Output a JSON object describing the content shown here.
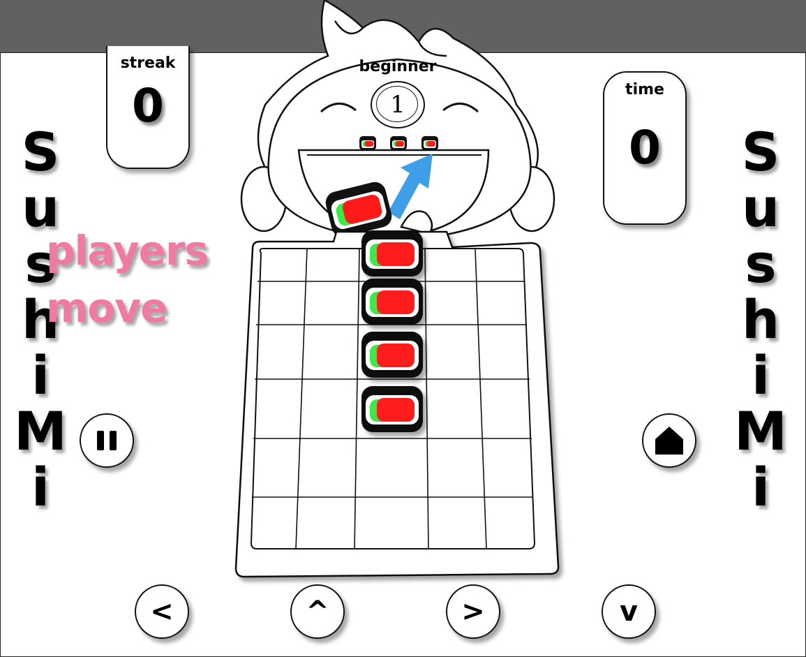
{
  "game": {
    "title_letters": [
      "S",
      "u",
      "s",
      "h",
      "i",
      "M",
      "i"
    ],
    "difficulty": "beginner",
    "level": "1",
    "streak": {
      "label": "streak",
      "value": "0"
    },
    "time": {
      "label": "time",
      "value": "0"
    },
    "hint_line1": "players",
    "hint_line2": "move"
  },
  "controls": {
    "left": "<",
    "up": "^",
    "right": ">",
    "down": "v"
  },
  "colors": {
    "topbar": "#616161",
    "hint_pink": "#f17ba0",
    "arrow_blue": "#3e9ee8",
    "sushi_red": "#ff1a1a",
    "sushi_green": "#3de84a"
  },
  "icons": {
    "pause": "pause-icon",
    "home": "home-icon"
  }
}
